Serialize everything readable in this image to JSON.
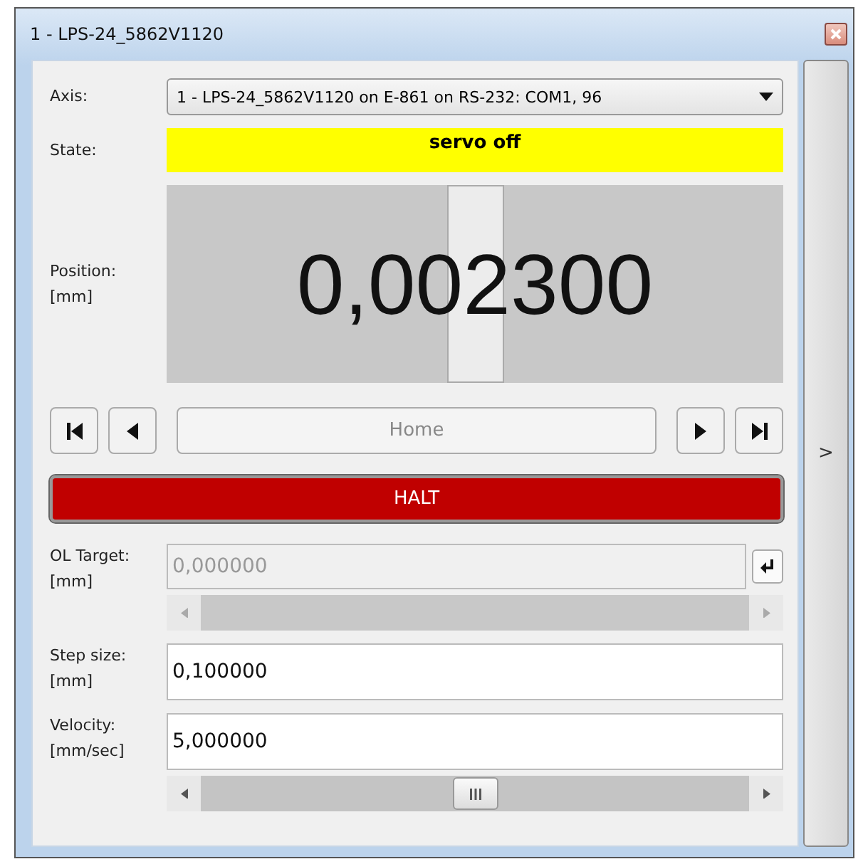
{
  "window": {
    "title": "1 - LPS-24_5862V1120"
  },
  "axis": {
    "label": "Axis:",
    "value": "1 - LPS-24_5862V1120 on E-861 on RS-232: COM1, 96"
  },
  "state": {
    "label": "State:",
    "value": "servo off"
  },
  "position": {
    "label": "Position:",
    "unit": "[mm]",
    "value": "0,002300",
    "level": 0.5
  },
  "nav_buttons": [
    {
      "kind": "first"
    },
    {
      "kind": "prev"
    },
    {
      "kind": "home",
      "label": "Home",
      "disabled": true
    },
    {
      "kind": "next"
    },
    {
      "kind": "last"
    }
  ],
  "halt": {
    "label": "HALT"
  },
  "ol_target": {
    "label": "OL Target:",
    "unit": "[mm]",
    "value": "0,000000",
    "disabled": true
  },
  "step_size": {
    "label": "Step size:",
    "unit": "[mm]",
    "value": "0,100000"
  },
  "velocity": {
    "label": "Velocity:",
    "unit": "[mm/sec]",
    "value": "5,000000"
  },
  "side_toggle": {
    "label": ">"
  }
}
